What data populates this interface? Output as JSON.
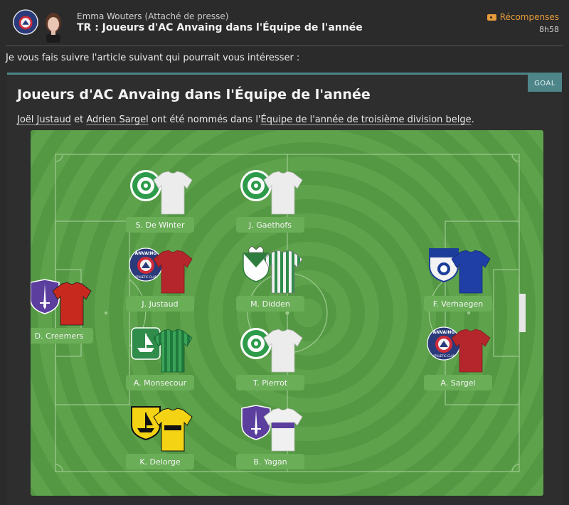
{
  "message": {
    "sender_name": "Emma Wouters",
    "sender_role": "(Attaché de presse)",
    "subject": "TR : Joueurs d'AC Anvaing dans l'Équipe de l'année",
    "rewards_label": "Récompenses",
    "time": "8h58",
    "intro": "Je vous fais suivre l'article suivant qui pourrait vous intéresser :"
  },
  "article": {
    "tag": "GOAL",
    "title": "Joueurs d'AC Anvaing dans l'Équipe de l'année",
    "text_player1": "Joël Justaud",
    "text_and": " et ",
    "text_player2": "Adrien Sargel",
    "text_middle": " ont été nommés dans l'",
    "text_award": "Équipe de l'année de troisième division belge",
    "text_end": "."
  },
  "players": [
    {
      "name": "S. De Winter",
      "club": "green-white-club",
      "shirt": "white"
    },
    {
      "name": "J. Gaethofs",
      "club": "green-white-club",
      "shirt": "white"
    },
    {
      "name": "J. Justaud",
      "club": "ac-anvaing",
      "shirt": "red"
    },
    {
      "name": "M. Didden",
      "club": "green-white-stripes-club",
      "shirt": "green-white-stripes"
    },
    {
      "name": "F. Verhaegen",
      "club": "blue-shield-club",
      "shirt": "blue"
    },
    {
      "name": "D. Creemers",
      "club": "purple-sword-club",
      "shirt": "red"
    },
    {
      "name": "A. Monsecour",
      "club": "ship-club",
      "shirt": "green-stripes"
    },
    {
      "name": "T. Pierrot",
      "club": "green-white-club",
      "shirt": "white"
    },
    {
      "name": "A. Sargel",
      "club": "ac-anvaing",
      "shirt": "red"
    },
    {
      "name": "K. Delorge",
      "club": "yellow-ship-club",
      "shirt": "yellow"
    },
    {
      "name": "B. Yagan",
      "club": "purple-sword-club",
      "shirt": "white-purple"
    }
  ],
  "badge_text": {
    "anvaing": "ANVAING",
    "athletic": "ATHLETIC CLUB"
  },
  "colors": {
    "accent": "#e69a3a",
    "tag": "#4d8589",
    "pitch": "#5ea24c",
    "name_plate": "#6aae57"
  }
}
